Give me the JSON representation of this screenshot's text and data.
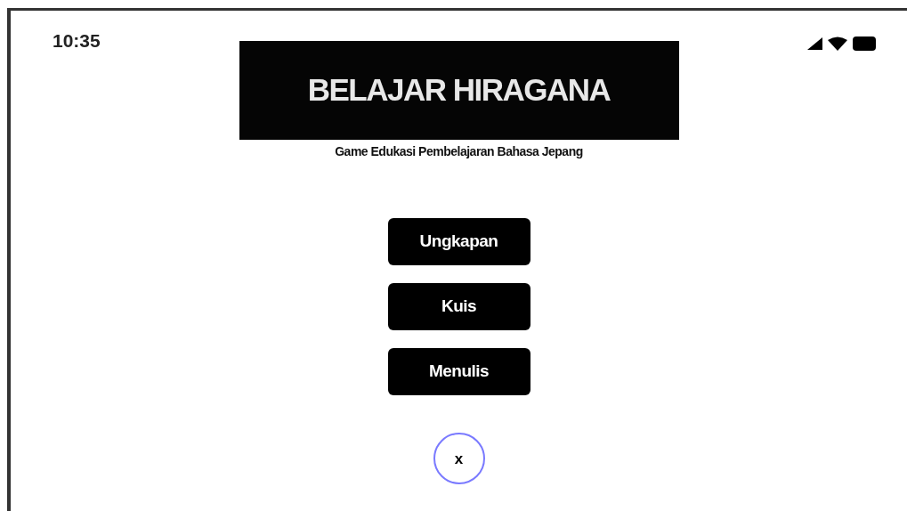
{
  "status_bar": {
    "time": "10:35"
  },
  "header": {
    "title": "BELAJAR HIRAGANA",
    "subtitle": "Game Edukasi Pembelajaran Bahasa Jepang"
  },
  "menu_buttons": [
    {
      "label": "Ungkapan"
    },
    {
      "label": "Kuis"
    },
    {
      "label": "Menulis"
    }
  ],
  "close_button": {
    "label": "x"
  }
}
